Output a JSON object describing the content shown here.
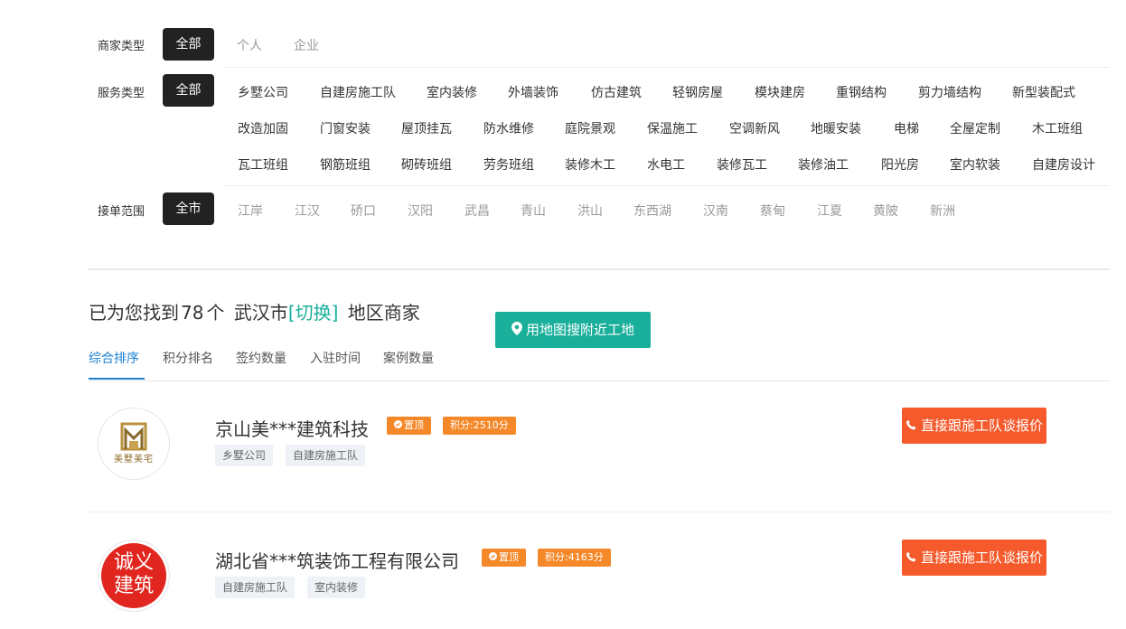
{
  "filters": {
    "merchant_type": {
      "label": "商家类型",
      "all": "全部",
      "options": [
        "个人",
        "企业"
      ]
    },
    "service_type": {
      "label": "服务类型",
      "all": "全部",
      "rows": [
        [
          "乡墅公司",
          "自建房施工队",
          "室内装修",
          "外墙装饰",
          "仿古建筑",
          "轻钢房屋",
          "模块建房",
          "重钢结构",
          "剪力墙结构",
          "新型装配式"
        ],
        [
          "改造加固",
          "门窗安装",
          "屋顶挂瓦",
          "防水维修",
          "庭院景观",
          "保温施工",
          "空调新风",
          "地暖安装",
          "电梯",
          "全屋定制",
          "木工班组"
        ],
        [
          "瓦工班组",
          "钢筋班组",
          "砌砖班组",
          "劳务班组",
          "装修木工",
          "水电工",
          "装修瓦工",
          "装修油工",
          "阳光房",
          "室内软装",
          "自建房设计"
        ]
      ]
    },
    "area": {
      "label": "接单范围",
      "all": "全市",
      "options": [
        "江岸",
        "江汉",
        "硚口",
        "汉阳",
        "武昌",
        "青山",
        "洪山",
        "东西湖",
        "汉南",
        "蔡甸",
        "江夏",
        "黄陂",
        "新洲"
      ]
    }
  },
  "results": {
    "prefix": "已为您找到",
    "count": "78",
    "unit": "个",
    "city": "武汉市",
    "switch_label": "[切换]",
    "suffix": "地区商家",
    "map_button": "用地图搜附近工地"
  },
  "sort_tabs": [
    "综合排序",
    "积分排名",
    "签约数量",
    "入驻时间",
    "案例数量"
  ],
  "merchants": [
    {
      "name": "京山美***建筑科技",
      "top_badge": "置顶",
      "score": "积分:2510分",
      "tags": [
        "乡墅公司",
        "自建房施工队"
      ],
      "logo_text": "美墅美宅",
      "quote_button": "直接跟施工队谈报价"
    },
    {
      "name": "湖北省***筑装饰工程有限公司",
      "top_badge": "置顶",
      "score": "积分:4163分",
      "tags": [
        "自建房施工队",
        "室内装修"
      ],
      "logo_text": "诚义建筑",
      "quote_button": "直接跟施工队谈报价"
    }
  ],
  "colors": {
    "accent": "#1aaf9a",
    "tab_active": "#1a7fd1",
    "quote": "#f55a2c",
    "badge": "#f5892a",
    "dark": "#222222"
  }
}
